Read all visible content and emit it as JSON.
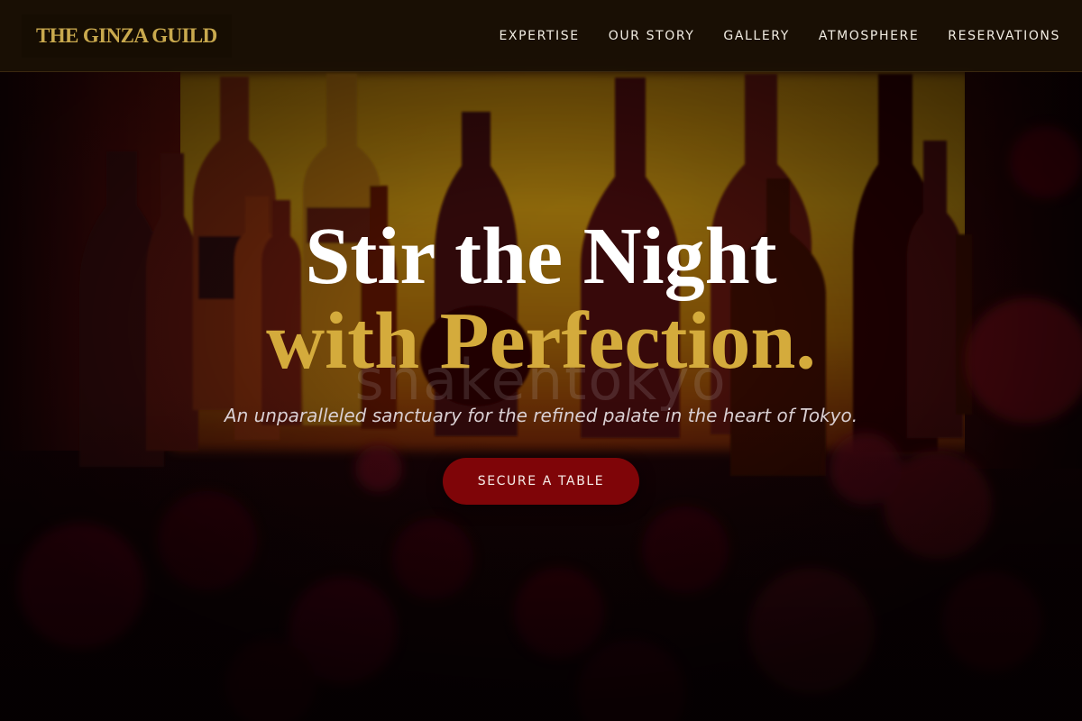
{
  "header": {
    "brand": "THE GINZA GUILD",
    "nav": [
      {
        "label": "EXPERTISE"
      },
      {
        "label": "OUR STORY"
      },
      {
        "label": "GALLERY"
      },
      {
        "label": "ATMOSPHERE"
      },
      {
        "label": "RESERVATIONS"
      }
    ]
  },
  "hero": {
    "headline_line1": "Stir the Night",
    "headline_line2": "with Perfection.",
    "tagline": "An unparalleled sanctuary for the refined palate in the heart of Tokyo.",
    "cta_label": "SECURE A TABLE",
    "watermark": "shakentokyo"
  },
  "colors": {
    "accent_gold": "#d4ab3c",
    "cta_red": "#7f0508",
    "nav_bg": "#1a1004"
  }
}
